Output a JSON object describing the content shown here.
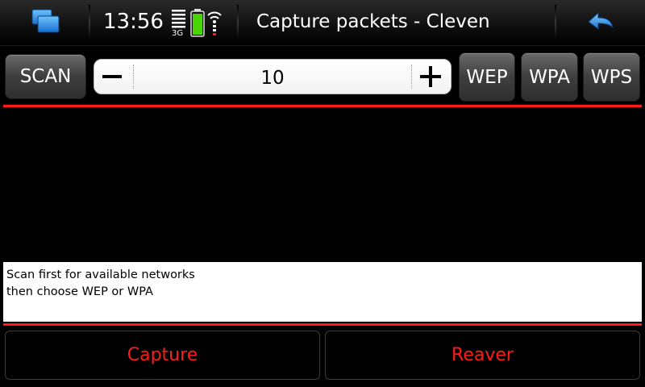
{
  "statusbar": {
    "time": "13:56",
    "network_type": "3G",
    "title": "Capture packets - Cleven",
    "battery_color": "#4ad400",
    "icons": [
      "task-switcher-icon",
      "signal-icon",
      "battery-icon",
      "wifi-icon",
      "back-arrow-icon"
    ]
  },
  "toolbar": {
    "scan_label": "SCAN",
    "stepper_value": "10",
    "wep_label": "WEP",
    "wpa_label": "WPA",
    "wps_label": "WPS"
  },
  "output": {
    "lines": [
      "Scan first for available networks",
      "then choose WEP or WPA"
    ]
  },
  "actions": {
    "capture_label": "Capture",
    "reaver_label": "Reaver"
  },
  "colors": {
    "accent_red": "#ff1a1a"
  }
}
